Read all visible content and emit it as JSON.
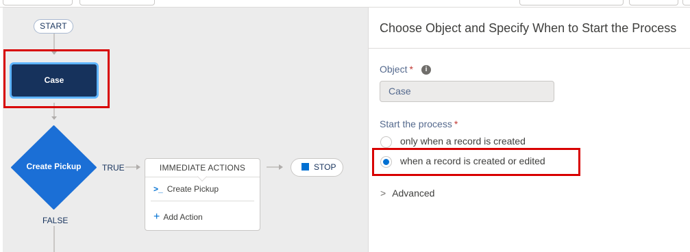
{
  "flow": {
    "start_label": "START",
    "object_node_label": "Case",
    "criteria_node_label": "Create Pickup",
    "true_label": "TRUE",
    "false_label": "FALSE",
    "actions": {
      "header": "IMMEDIATE ACTIONS",
      "items": [
        {
          "label": "Create Pickup",
          "icon": "apex-icon"
        }
      ],
      "add_label": "Add Action"
    },
    "stop_label": "STOP"
  },
  "panel": {
    "title": "Choose Object and Specify When to Start the Process",
    "object_label": "Object",
    "object_value": "Case",
    "start_label": "Start the process",
    "options": [
      {
        "label": "only when a record is created",
        "selected": false
      },
      {
        "label": "when a record is created or edited",
        "selected": true
      }
    ],
    "advanced_label": "Advanced"
  },
  "colors": {
    "node_dark": "#16325c",
    "node_highlight": "#5eb4ff",
    "decision_blue": "#1b6fd6",
    "accent": "#0070d2",
    "highlight_box": "#d80000"
  }
}
